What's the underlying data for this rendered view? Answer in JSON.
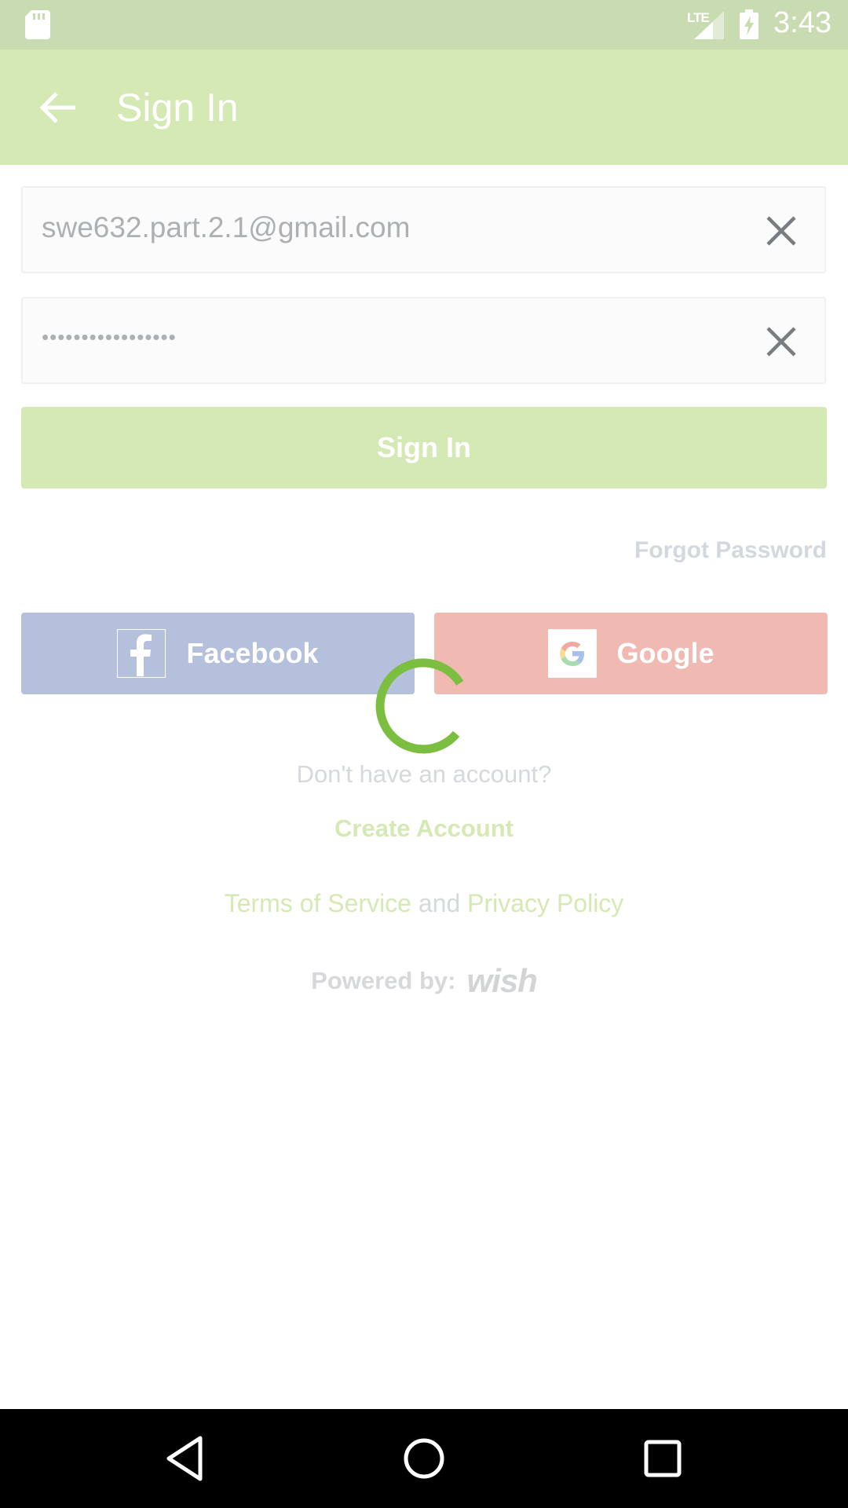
{
  "status_bar": {
    "network_label": "LTE",
    "time": "3:43"
  },
  "app_bar": {
    "title": "Sign In"
  },
  "form": {
    "email_value": "swe632.part.2.1@gmail.com",
    "password_value": "•••••••••••••••••",
    "sign_in_label": "Sign In",
    "forgot_password_label": "Forgot Password"
  },
  "social": {
    "facebook_label": "Facebook",
    "google_label": "Google"
  },
  "footer": {
    "no_account_text": "Don't have an account?",
    "create_account_label": "Create Account",
    "terms_label": "Terms of Service",
    "and_text": "and",
    "privacy_label": "Privacy Policy",
    "powered_by_label": "Powered by:",
    "brand_name": "wish"
  },
  "colors": {
    "accent_green": "#d4e9b4",
    "spinner_green": "#7cbf40",
    "facebook_blue": "#b5c0dc",
    "google_red": "#f0b9b1"
  }
}
